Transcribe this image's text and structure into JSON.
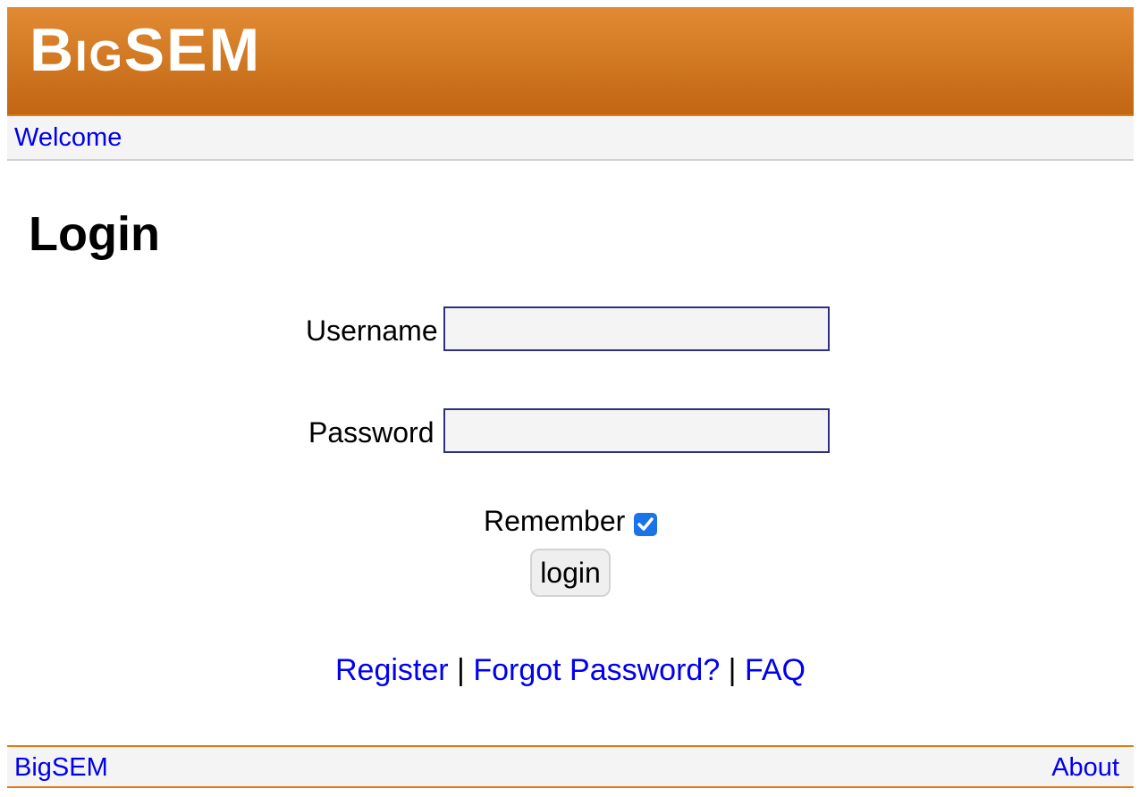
{
  "header": {
    "logo": "BigSEM"
  },
  "nav": {
    "welcome": "Welcome"
  },
  "page": {
    "title": "Login"
  },
  "form": {
    "username_label": "Username",
    "username_value": "",
    "password_label": "Password",
    "password_value": "",
    "remember_label": "Remember",
    "remember_checked": true,
    "login_button": "login"
  },
  "links": {
    "register": "Register",
    "separator1": " | ",
    "forgot_password": "Forgot Password?",
    "separator2": " | ",
    "faq": "FAQ"
  },
  "footer": {
    "home": "BigSEM",
    "about": "About"
  },
  "colors": {
    "header_top": "#e18a33",
    "header_bottom": "#c16613",
    "link": "#0000ee",
    "field_border": "#2e2f80",
    "checkbox": "#1a73e8"
  }
}
